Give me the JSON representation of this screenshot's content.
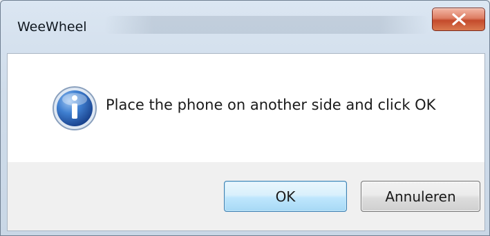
{
  "window": {
    "title": "WeeWheel",
    "close_icon": "close-icon"
  },
  "dialog": {
    "icon": "info-icon",
    "message": "Place the phone on another side and click OK"
  },
  "buttons": {
    "ok_label": "OK",
    "cancel_label": "Annuleren"
  },
  "colors": {
    "close_button": "#c44a2c",
    "info_icon": "#2a62b8",
    "default_button_border": "#3c7fb1"
  }
}
